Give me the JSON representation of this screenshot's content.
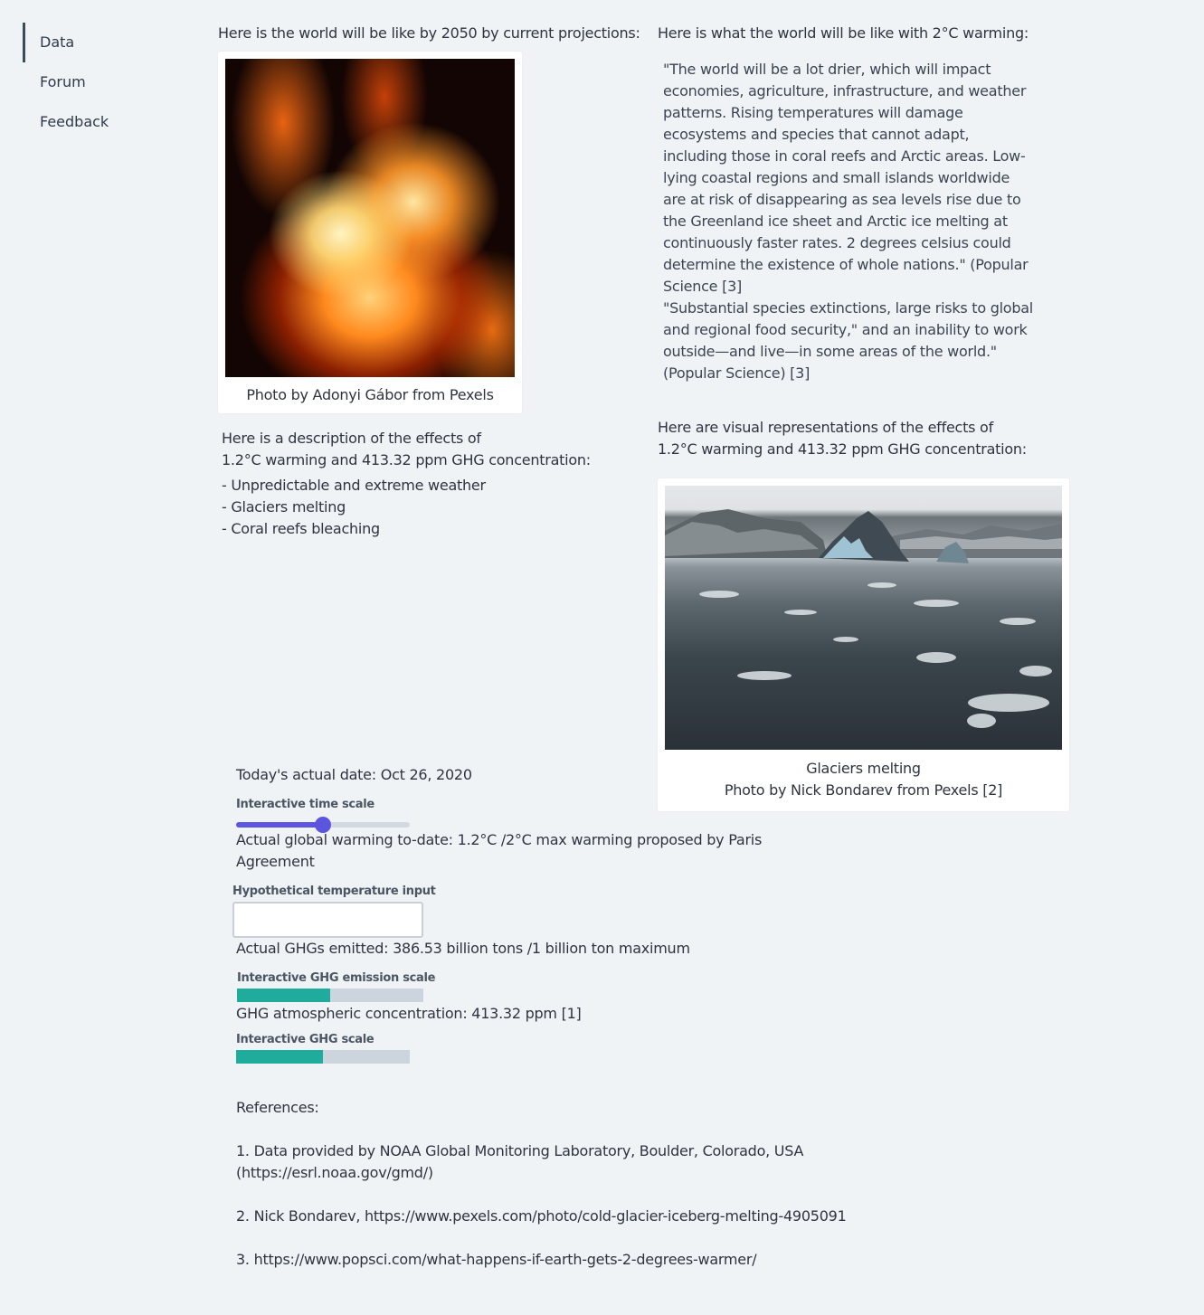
{
  "sidebar": {
    "items": [
      {
        "label": "Data"
      },
      {
        "label": "Forum"
      },
      {
        "label": "Feedback"
      }
    ]
  },
  "projection": {
    "heading": "Here is the world will be like by 2050 by current projections:",
    "caption": "Photo by Adonyi Gábor from Pexels"
  },
  "two_degree": {
    "heading": "Here is what the world will be like with 2°C warming:",
    "quote": "\"The world will be a lot drier, which will impact economies, agriculture, infrastructure, and weather patterns. Rising temperatures will damage ecosystems and species that cannot adapt, including those in coral reefs and Arctic areas. Low-lying coastal regions and small islands worldwide are at risk of disappearing as sea levels rise due to the Greenland ice sheet and Arctic ice melting at continuously faster rates. 2 degrees celsius could determine the existence of whole nations.\" (Popular Science [3]",
    "quote2": "\"Substantial species extinctions, large risks to global and regional food security,\" and an inability to work outside—and live—in some areas of the world.\"  (Popular Science) [3]"
  },
  "effects": {
    "line1": "Here is a description of the effects of",
    "line2": "1.2°C warming and 413.32 ppm GHG concentration:",
    "items": [
      "- Unpredictable and extreme weather",
      "- Glaciers melting",
      "- Coral reefs bleaching"
    ]
  },
  "visual": {
    "line1": "Here are visual representations of the effects of",
    "line2": "1.2°C warming and 413.32 ppm GHG concentration:",
    "caption1": "Glaciers melting",
    "caption2": "Photo by Nick Bondarev from Pexels [2]"
  },
  "controls": {
    "date_text": "Today's actual date: Oct 26, 2020",
    "time_scale_label": "Interactive time scale",
    "time_scale_value": 0.5,
    "warming_line1": "Actual global warming to-date: 1.2°C    /2°C max warming proposed by Paris",
    "warming_line2": "Agreement",
    "temp_input_label": "Hypothetical temperature input",
    "temp_input_value": "",
    "ghg_emitted": "Actual GHGs emitted: 386.53 billion tons    /1 billion ton maximum",
    "ghg_emission_label": "Interactive GHG emission scale",
    "ghg_emission_value": 0.5,
    "ghg_concentration": "GHG atmospheric concentration: 413.32 ppm [1]",
    "ghg_scale_label": "Interactive GHG scale",
    "ghg_scale_value": 0.5
  },
  "references": {
    "heading": "References:",
    "ref1_line1": "1. Data provided by NOAA Global Monitoring Laboratory, Boulder, Colorado, USA",
    "ref1_line2": "(https://esrl.noaa.gov/gmd/)",
    "ref2": "2. Nick Bondarev, https://www.pexels.com/photo/cold-glacier-iceberg-melting-4905091",
    "ref3": "3. https://www.popsci.com/what-happens-if-earth-gets-2-degrees-warmer/"
  },
  "colors": {
    "background": "#f0f3f6",
    "slider_accent": "#5b55e0",
    "bar_fill": "#20ac9c",
    "bar_track": "#ccd4dd"
  }
}
